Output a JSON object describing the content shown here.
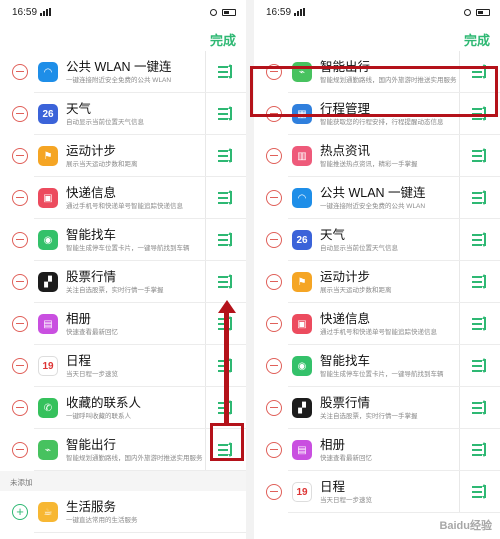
{
  "status": {
    "time": "16:59"
  },
  "done_label": "完成",
  "section_unadded": "未添加",
  "colors": {
    "accent": "#2eb873",
    "remove": "#e0605a",
    "highlight": "#b4121a"
  },
  "left_list": [
    {
      "title": "公共 WLAN 一键连",
      "desc": "一键连接附近安全免费的公共 WLAN",
      "icon": "wifi-icon",
      "color": "#1e8ee8",
      "glyph": "◠"
    },
    {
      "title": "天气",
      "desc": "自动显示当前位置天气信息",
      "icon": "weather-icon",
      "color": "#3b63d9",
      "glyph": "26"
    },
    {
      "title": "运动计步",
      "desc": "展示当天运动步数和距离",
      "icon": "walking-icon",
      "color": "#f5a524",
      "glyph": "⚑"
    },
    {
      "title": "快递信息",
      "desc": "通过手机号和快递单号智能追踪快递信息",
      "icon": "delivery-truck-icon",
      "color": "#ec4b5e",
      "glyph": "▣"
    },
    {
      "title": "智能找车",
      "desc": "智能生成停车位置卡片，一键导航找到车辆",
      "icon": "car-pin-icon",
      "color": "#34c16a",
      "glyph": "◉"
    },
    {
      "title": "股票行情",
      "desc": "关注自选股票，实时行情一手掌握",
      "icon": "stock-chart-icon",
      "color": "#1c1c1c",
      "glyph": "▞"
    },
    {
      "title": "相册",
      "desc": "快速查看最新回忆",
      "icon": "photo-album-icon",
      "color": "#c94fe0",
      "glyph": "▤"
    },
    {
      "title": "日程",
      "desc": "当天日程一步速览",
      "icon": "calendar-icon",
      "color": "#ffffff",
      "glyph": "19"
    },
    {
      "title": "收藏的联系人",
      "desc": "一键呼叫收藏的联系人",
      "icon": "phone-icon",
      "color": "#35c15c",
      "glyph": "✆"
    },
    {
      "title": "智能出行",
      "desc": "智能规划通勤路线，国内外旅游时推送实用服务",
      "icon": "smart-travel-icon",
      "color": "#47c25f",
      "glyph": "⌁"
    }
  ],
  "left_unadded": [
    {
      "title": "生活服务",
      "desc": "一键直达常用的生活服务",
      "icon": "life-service-icon",
      "color": "#f7b733",
      "glyph": "☕"
    }
  ],
  "right_list": [
    {
      "title": "智能出行",
      "desc": "智能规划通勤路线，国内外旅游时推送实用服务",
      "icon": "smart-travel-icon",
      "color": "#47c25f",
      "glyph": "⌁"
    },
    {
      "title": "行程管理",
      "desc": "智能获取您的行程安排，行程提醒动态信息",
      "icon": "itinerary-icon",
      "color": "#2f7fdd",
      "glyph": "▦"
    },
    {
      "title": "热点资讯",
      "desc": "智能推送热点资讯，精彩一手掌握",
      "icon": "news-icon",
      "color": "#ee5a7a",
      "glyph": "▥"
    },
    {
      "title": "公共 WLAN 一键连",
      "desc": "一键连接附近安全免费的公共 WLAN",
      "icon": "wifi-icon",
      "color": "#1e8ee8",
      "glyph": "◠"
    },
    {
      "title": "天气",
      "desc": "自动显示当前位置天气信息",
      "icon": "weather-icon",
      "color": "#3b63d9",
      "glyph": "26"
    },
    {
      "title": "运动计步",
      "desc": "展示当天运动步数和距离",
      "icon": "walking-icon",
      "color": "#f5a524",
      "glyph": "⚑"
    },
    {
      "title": "快递信息",
      "desc": "通过手机号和快递单号智能追踪快递信息",
      "icon": "delivery-truck-icon",
      "color": "#ec4b5e",
      "glyph": "▣"
    },
    {
      "title": "智能找车",
      "desc": "智能生成停车位置卡片，一键导航找到车辆",
      "icon": "car-pin-icon",
      "color": "#34c16a",
      "glyph": "◉"
    },
    {
      "title": "股票行情",
      "desc": "关注自选股票，实时行情一手掌握",
      "icon": "stock-chart-icon",
      "color": "#1c1c1c",
      "glyph": "▞"
    },
    {
      "title": "相册",
      "desc": "快速查看最新回忆",
      "icon": "photo-album-icon",
      "color": "#c94fe0",
      "glyph": "▤"
    },
    {
      "title": "日程",
      "desc": "当天日程一步速览",
      "icon": "calendar-icon",
      "color": "#ffffff",
      "glyph": "19"
    }
  ],
  "watermark": "Baidu经验"
}
